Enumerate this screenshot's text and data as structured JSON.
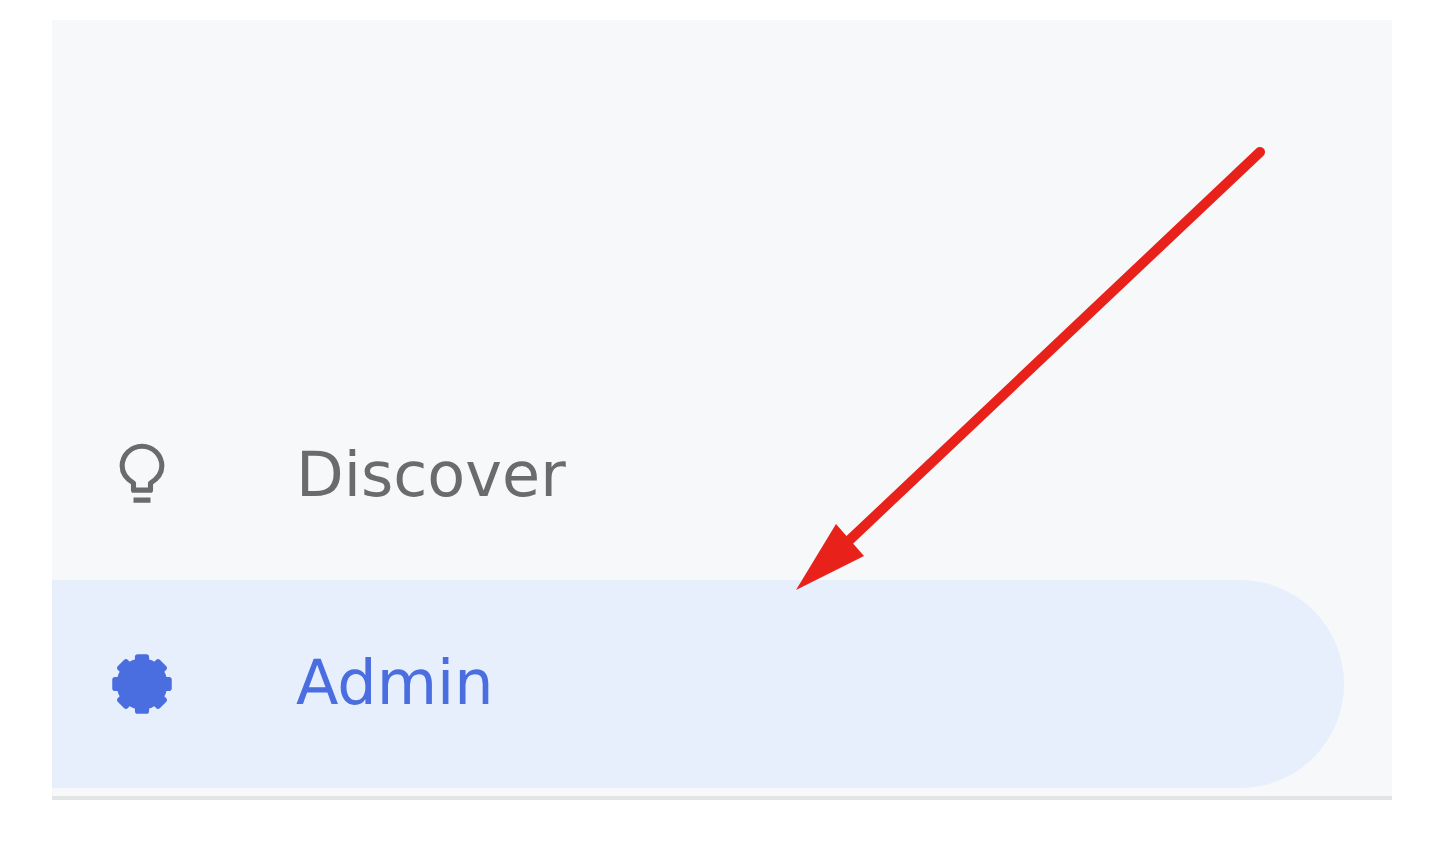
{
  "sidebar": {
    "items": [
      {
        "label": "Discover",
        "selected": false,
        "kind": "bulb"
      },
      {
        "label": "Admin",
        "selected": true,
        "kind": "gear"
      }
    ]
  }
}
